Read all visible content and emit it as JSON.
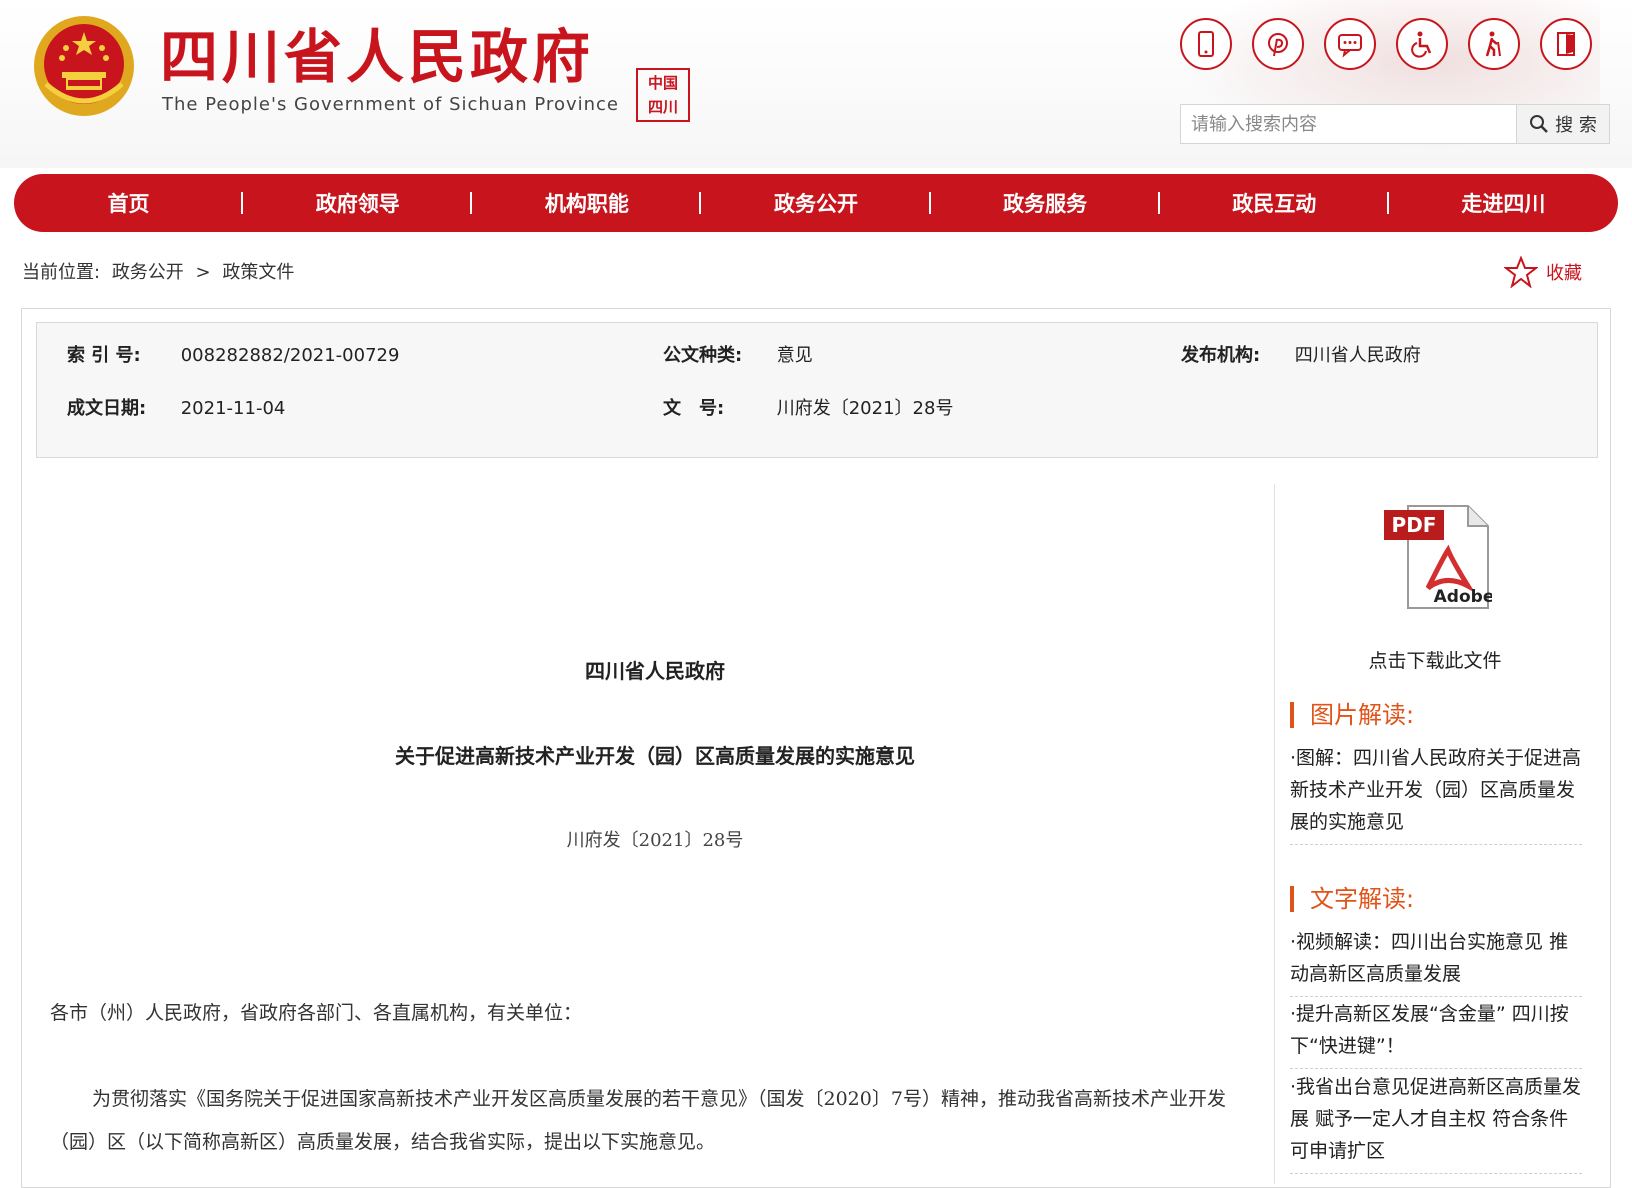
{
  "header": {
    "title": "四川省人民政府",
    "subtitle": "The People's Government of Sichuan Province",
    "seal_text": "中国 四川",
    "tool_icons": [
      "mobile-icon",
      "pinterest-icon",
      "message-icon",
      "accessibility-icon",
      "elderly-icon",
      "exit-icon"
    ]
  },
  "search": {
    "placeholder": "请输入搜索内容",
    "button_label": "搜 索"
  },
  "nav": {
    "items": [
      "首页",
      "政府领导",
      "机构职能",
      "政务公开",
      "政务服务",
      "政民互动",
      "走进四川"
    ]
  },
  "breadcrumb": {
    "label": "当前位置:",
    "items": [
      "政务公开",
      ">",
      "政策文件"
    ]
  },
  "favorite": {
    "label": "收藏"
  },
  "meta": {
    "index_label": "索 引 号:",
    "index_value": "008282882/2021-00729",
    "type_label": "公文种类:",
    "type_value": "意见",
    "publisher_label": "发布机构:",
    "publisher_value": "四川省人民政府",
    "date_label": "成文日期:",
    "date_value": "2021-11-04",
    "docno_label": "文　号:",
    "docno_value": "川府发〔2021〕28号"
  },
  "document": {
    "issuer": "四川省人民政府",
    "title": "关于促进高新技术产业开发（园）区高质量发展的实施意见",
    "number": "川府发〔2021〕28号",
    "salutation": "各市（州）人民政府，省政府各部门、各直属机构，有关单位：",
    "paragraph": "为贯彻落实《国务院关于促进国家高新技术产业开发区高质量发展的若干意见》（国发〔2020〕7号）精神，推动我省高新技术产业开发（园）区（以下简称高新区）高质量发展，结合我省实际，提出以下实施意见。"
  },
  "sidebar": {
    "pdf_caption": "点击下载此文件",
    "pdf_badge": "PDF",
    "pdf_brand": "Adobe",
    "picture_heading": "图片解读:",
    "picture_links": [
      "·图解：四川省人民政府关于促进高新技术产业开发（园）区高质量发展的实施意见"
    ],
    "text_heading": "文字解读:",
    "text_links": [
      "·视频解读：四川出台实施意见 推动高新区高质量发展",
      "·提升高新区发展“含金量” 四川按下“快进键”！",
      "·我省出台意见促进高新区高质量发展 赋予一定人才自主权 符合条件可申请扩区"
    ]
  },
  "colors": {
    "brand_red": "#c8151d",
    "accent_orange": "#e0541a"
  }
}
